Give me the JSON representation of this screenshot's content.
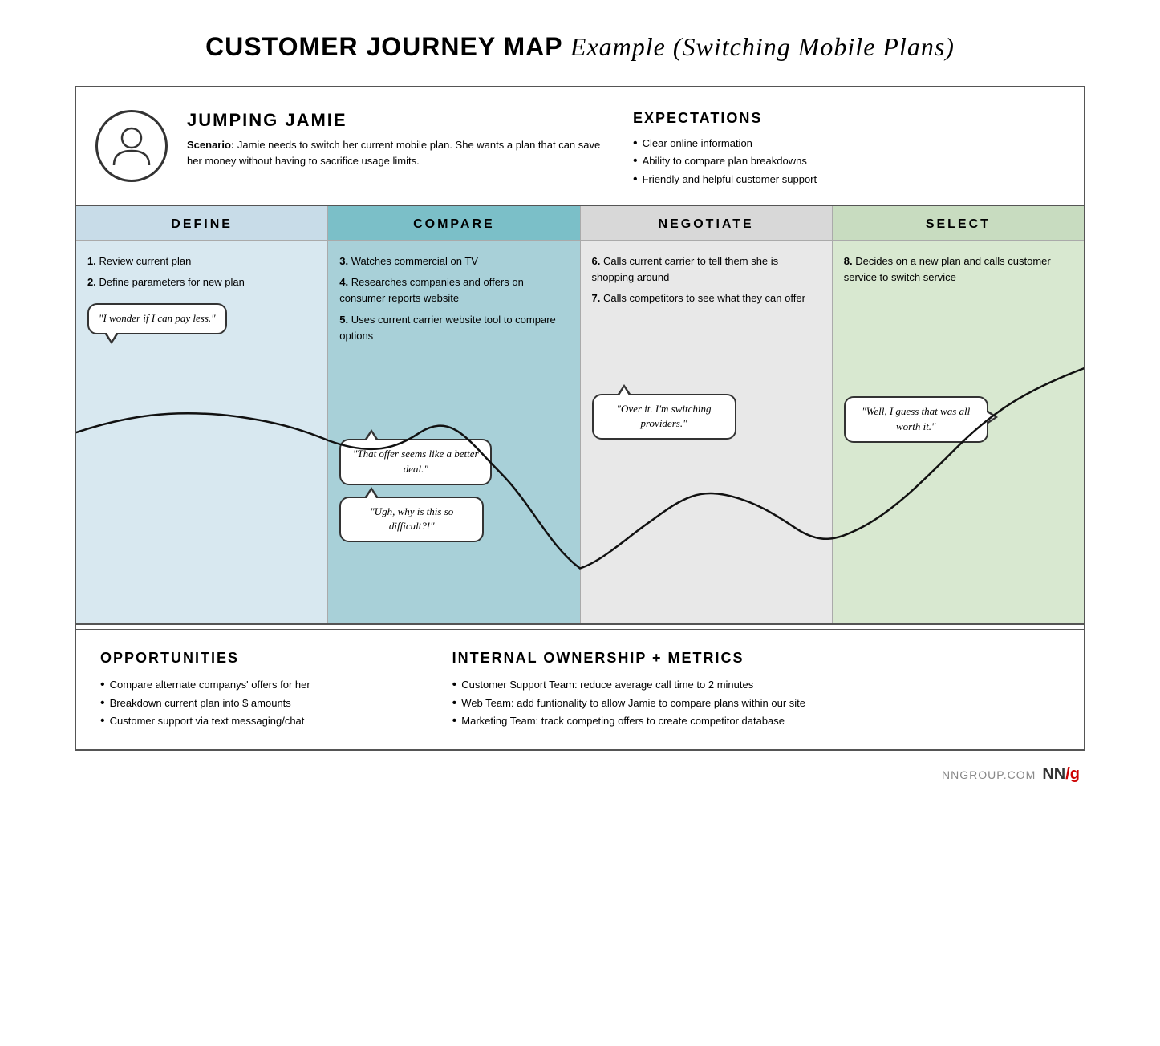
{
  "title": {
    "bold": "CUSTOMER JOURNEY MAP",
    "italic": "Example (Switching Mobile Plans)"
  },
  "persona": {
    "name": "JUMPING JAMIE",
    "scenario_label": "Scenario:",
    "scenario_text": "Jamie needs to switch her current mobile plan. She wants a plan that can save her money without having to sacrifice usage limits."
  },
  "expectations": {
    "title": "EXPECTATIONS",
    "items": [
      "Clear online information",
      "Ability to compare plan breakdowns",
      "Friendly and helpful customer support"
    ]
  },
  "phases": [
    {
      "id": "define",
      "label": "DEFINE",
      "steps": [
        {
          "num": "1.",
          "text": "Review current plan"
        },
        {
          "num": "2.",
          "text": "Define parameters for new plan"
        }
      ],
      "bubble": "\"I wonder if I can pay less.\""
    },
    {
      "id": "compare",
      "label": "COMPARE",
      "steps": [
        {
          "num": "3.",
          "text": "Watches commercial on TV"
        },
        {
          "num": "4.",
          "text": "Researches companies and offers on consumer reports website"
        },
        {
          "num": "5.",
          "text": "Uses current carrier website tool to compare options"
        }
      ],
      "bubble": "\"That offer seems like a better deal.\""
    },
    {
      "id": "negotiate",
      "label": "NEGOTIATE",
      "steps": [
        {
          "num": "6.",
          "text": "Calls current carrier to tell them she is shopping around"
        },
        {
          "num": "7.",
          "text": "Calls competitors to see what they can offer"
        }
      ],
      "bubble": "\"Over it. I'm switching providers.\""
    },
    {
      "id": "select",
      "label": "SELECT",
      "steps": [
        {
          "num": "8.",
          "text": "Decides on a new plan and calls customer service to switch service"
        }
      ],
      "bubble": "\"Well, I guess that was all worth it.\""
    }
  ],
  "opportunities": {
    "title": "OPPORTUNITIES",
    "items": [
      "Compare alternate companys' offers for her",
      "Breakdown current plan into $ amounts",
      "Customer support via text messaging/chat"
    ]
  },
  "internal": {
    "title": "INTERNAL OWNERSHIP + METRICS",
    "items": [
      "Customer Support Team: reduce average call time to 2 minutes",
      "Web Team: add funtionality to allow Jamie to compare plans within our site",
      "Marketing Team: track competing offers to create competitor database"
    ]
  },
  "footer": {
    "text": "NNGROUP.COM",
    "logo": "NN/g"
  }
}
